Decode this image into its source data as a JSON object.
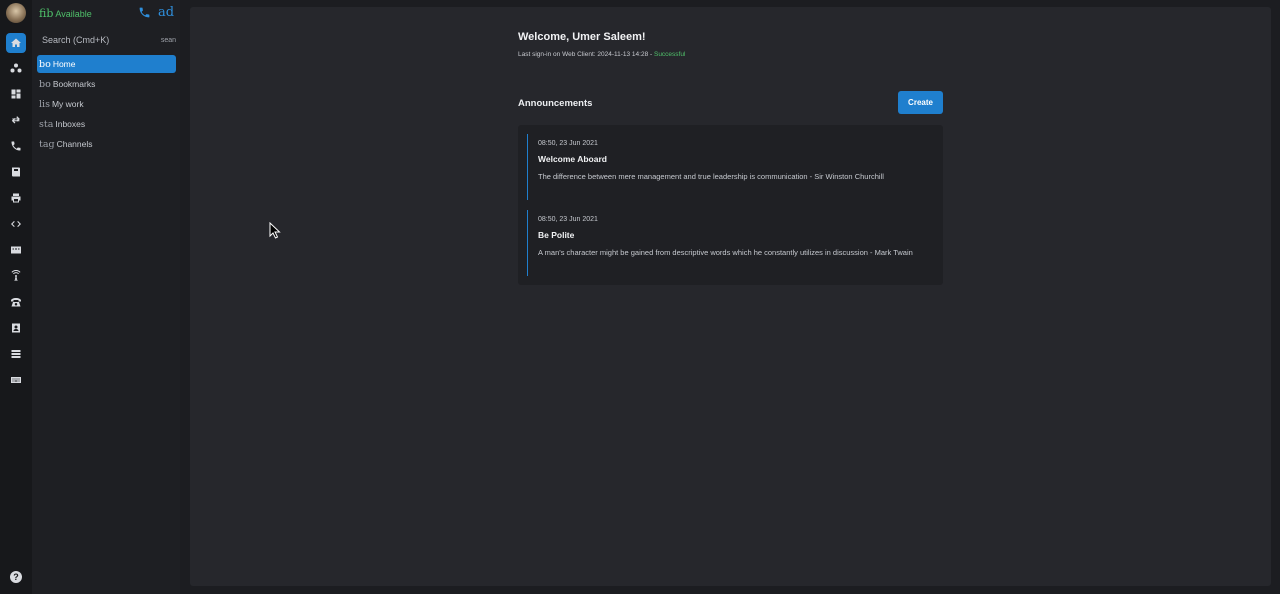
{
  "user": {
    "status": "Available",
    "status_glyph": "fib"
  },
  "header_actions": {
    "phone_icon": "phone-icon",
    "ad_label": "ad"
  },
  "search": {
    "placeholder": "Search (Cmd+K)",
    "suffix": "sean"
  },
  "nav": [
    {
      "glyph": "bo",
      "label": "Home",
      "active": true
    },
    {
      "glyph": "bo",
      "label": "Bookmarks",
      "active": false
    },
    {
      "glyph": "lis",
      "label": "My work",
      "active": false
    },
    {
      "glyph": "sta",
      "label": "Inboxes",
      "active": false
    },
    {
      "glyph": "tag",
      "label": "Channels",
      "active": false
    }
  ],
  "welcome": {
    "title": "Welcome, Umer Saleem!",
    "signin_prefix": "Last sign-in on Web Client: 2024-11-13 14:28 - ",
    "signin_status": "Successful"
  },
  "announcements": {
    "heading": "Announcements",
    "create_label": "Create",
    "items": [
      {
        "date": "08:50, 23 Jun 2021",
        "title": "Welcome Aboard",
        "body": "The difference between mere management and true leadership is communication - Sir Winston Churchill"
      },
      {
        "date": "08:50, 23 Jun 2021",
        "title": "Be Polite",
        "body": "A man's character might be gained from descriptive words which he constantly utilizes in discussion - Mark Twain"
      }
    ]
  },
  "help_label": "?",
  "colors": {
    "accent": "#1f7fce",
    "success": "#4fc06a",
    "background": "#1c1d21",
    "panel": "#26272c"
  }
}
